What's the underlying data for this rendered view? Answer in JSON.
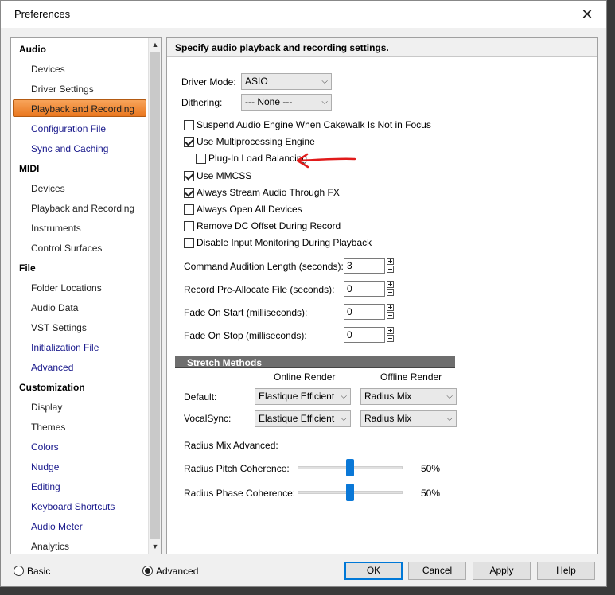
{
  "window": {
    "title": "Preferences",
    "close_glyph": "✕"
  },
  "sidebar": {
    "items": [
      {
        "label": "Audio",
        "type": "category"
      },
      {
        "label": "Devices",
        "type": "item"
      },
      {
        "label": "Driver Settings",
        "type": "item"
      },
      {
        "label": "Playback and Recording",
        "type": "item",
        "selected": true
      },
      {
        "label": "Configuration File",
        "type": "item"
      },
      {
        "label": "Sync and Caching",
        "type": "item"
      },
      {
        "label": "MIDI",
        "type": "category"
      },
      {
        "label": "Devices",
        "type": "item"
      },
      {
        "label": "Playback and Recording",
        "type": "item"
      },
      {
        "label": "Instruments",
        "type": "item"
      },
      {
        "label": "Control Surfaces",
        "type": "item"
      },
      {
        "label": "File",
        "type": "category"
      },
      {
        "label": "Folder Locations",
        "type": "item"
      },
      {
        "label": "Audio Data",
        "type": "item"
      },
      {
        "label": "VST Settings",
        "type": "item"
      },
      {
        "label": "Initialization File",
        "type": "item"
      },
      {
        "label": "Advanced",
        "type": "item"
      },
      {
        "label": "Customization",
        "type": "category"
      },
      {
        "label": "Display",
        "type": "item"
      },
      {
        "label": "Themes",
        "type": "item"
      },
      {
        "label": "Colors",
        "type": "item"
      },
      {
        "label": "Nudge",
        "type": "item"
      },
      {
        "label": "Editing",
        "type": "item"
      },
      {
        "label": "Keyboard Shortcuts",
        "type": "item"
      },
      {
        "label": "Audio Meter",
        "type": "item"
      },
      {
        "label": "Analytics",
        "type": "item"
      }
    ],
    "scroll_up_glyph": "▲",
    "scroll_down_glyph": "▼"
  },
  "panel": {
    "header": "Specify audio playback and recording settings.",
    "driver_mode": {
      "label": "Driver Mode:",
      "value": "ASIO"
    },
    "dithering": {
      "label": "Dithering:",
      "value": "--- None ---"
    },
    "checkboxes": [
      {
        "label": "Suspend Audio Engine When Cakewalk Is Not in Focus",
        "checked": false
      },
      {
        "label": "Use Multiprocessing Engine",
        "checked": true
      },
      {
        "label": "Plug-In Load Balancing",
        "checked": false
      },
      {
        "label": "Use MMCSS",
        "checked": true
      },
      {
        "label": "Always Stream Audio Through FX",
        "checked": true
      },
      {
        "label": "Always Open All Devices",
        "checked": false
      },
      {
        "label": "Remove DC Offset During Record",
        "checked": false
      },
      {
        "label": "Disable Input Monitoring During Playback",
        "checked": false
      }
    ],
    "numeric_fields": [
      {
        "label": "Command Audition Length (seconds):",
        "value": "3"
      },
      {
        "label": "Record Pre-Allocate File (seconds):",
        "value": "0"
      },
      {
        "label": "Fade On Start  (milliseconds):",
        "value": "0"
      },
      {
        "label": "Fade On Stop  (milliseconds):",
        "value": "0"
      }
    ],
    "stretch": {
      "title": "Stretch Methods",
      "col_online": "Online Render",
      "col_offline": "Offline Render",
      "rows": [
        {
          "label": "Default:",
          "online": "Elastique Efficient",
          "offline": "Radius Mix"
        },
        {
          "label": "VocalSync:",
          "online": "Elastique Efficient",
          "offline": "Radius Mix"
        }
      ]
    },
    "radius": {
      "title": "Radius Mix Advanced:",
      "pitch": {
        "label": "Radius Pitch Coherence:",
        "value": "50%",
        "level": 0.5
      },
      "phase": {
        "label": "Radius Phase Coherence:",
        "value": "50%",
        "level": 0.5
      }
    },
    "annotation_color": "#e11b1b"
  },
  "footer": {
    "basic": {
      "label": "Basic",
      "checked": false
    },
    "advanced": {
      "label": "Advanced",
      "checked": true
    },
    "ok": "OK",
    "cancel": "Cancel",
    "apply": "Apply",
    "help": "Help"
  },
  "colors": {
    "selected_item": "#f08a34",
    "link_blue": "#1a1a8c",
    "slider": "#0a78d7"
  }
}
